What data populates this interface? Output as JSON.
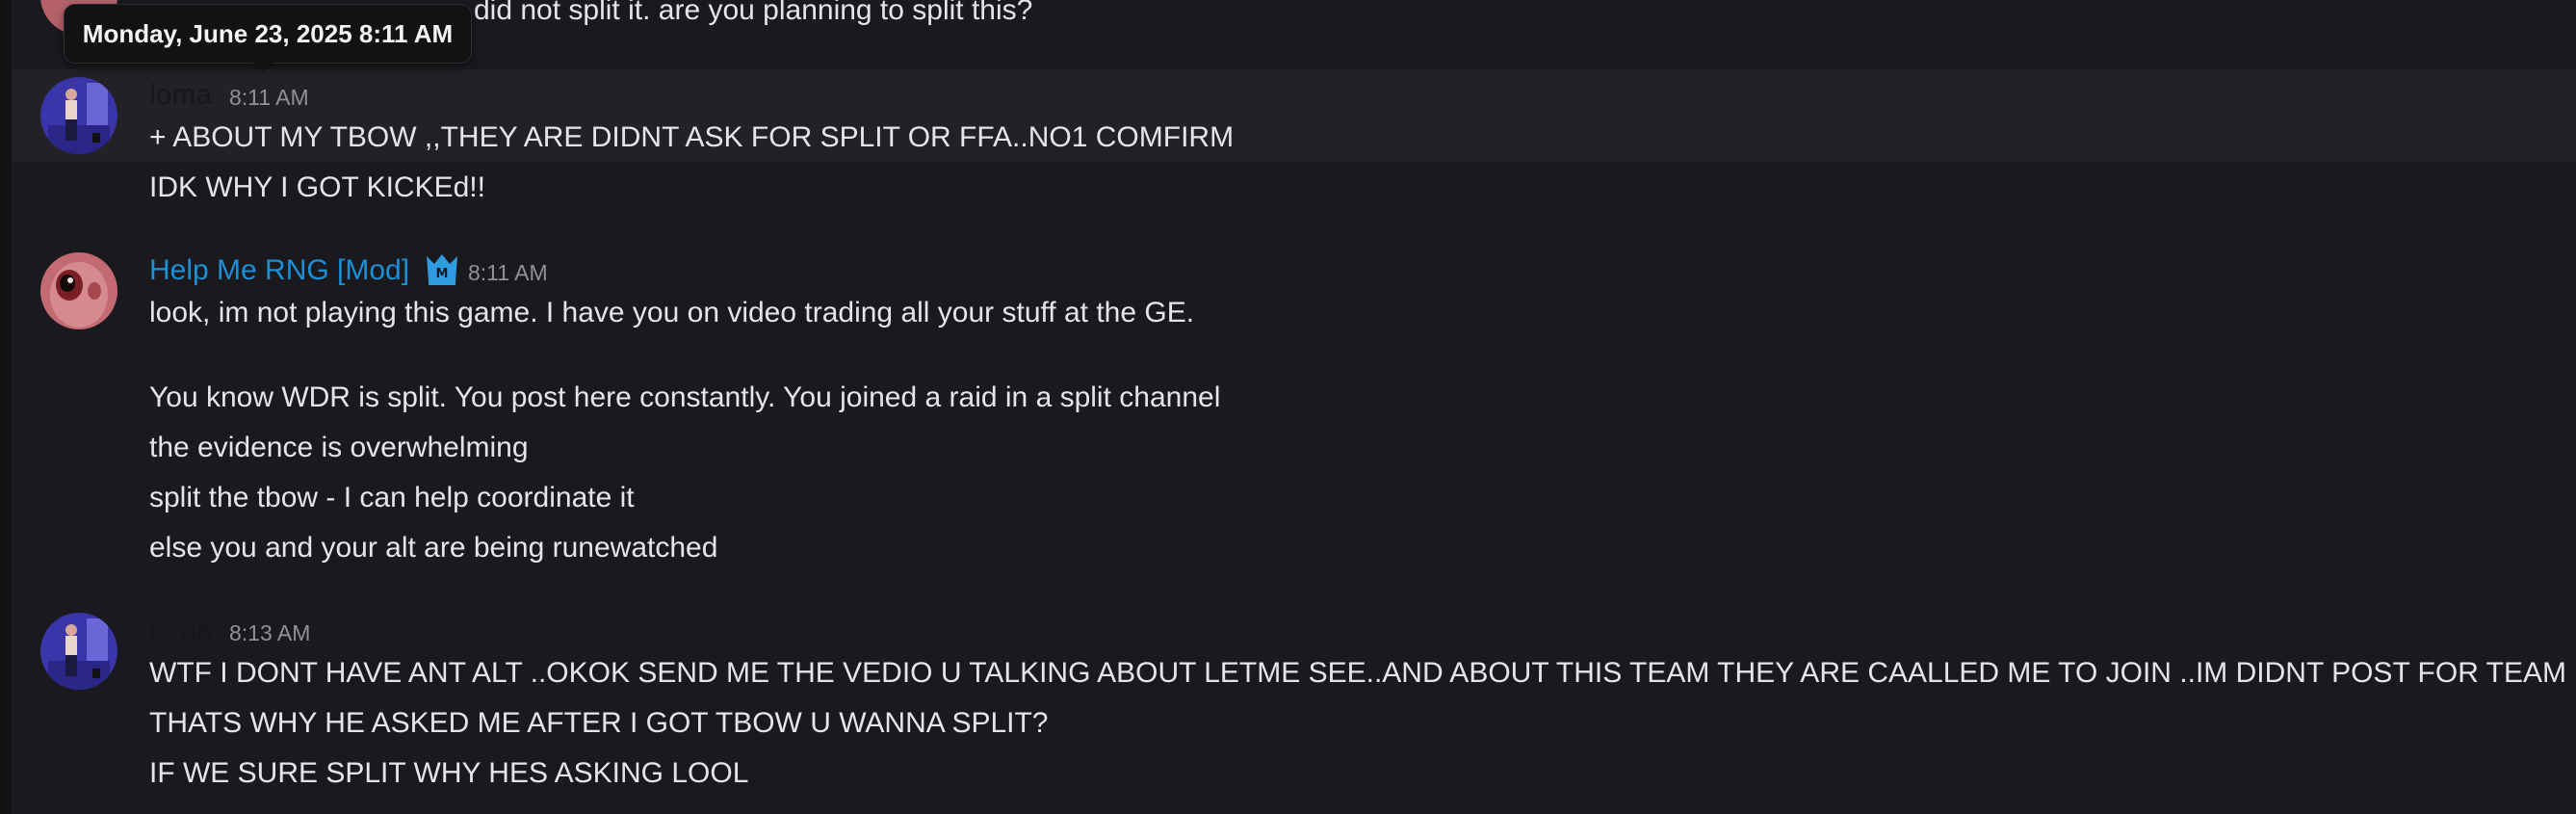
{
  "tooltip": {
    "text": "Monday, June 23, 2025 8:11 AM"
  },
  "colors": {
    "background": "#1a1a1e",
    "username_loma": "#17171a",
    "username_mod": "#1c8fd6",
    "mod_badge": "#2f9be0",
    "timestamp": "#8e9297",
    "text": "#e3e5e8"
  },
  "messages": [
    {
      "partial_text": "did not split it. are you planning to split this?"
    },
    {
      "author": "loma",
      "time": "8:11 AM",
      "avatar_icon": "loma-avatar-icon",
      "lines": [
        "+ ABOUT MY TBOW ,,THEY ARE DIDNT ASK FOR SPLIT OR FFA..NO1 COMFIRM",
        "IDK WHY I GOT KICKEd!!"
      ]
    },
    {
      "author": "Help Me RNG [Mod]",
      "time": "8:11 AM",
      "avatar_icon": "alien-avatar-icon",
      "badge_icon": "mod-crown-icon",
      "lines": [
        "look, im not playing this game. I have you on video trading all your stuff at the GE.",
        "You know WDR is split. You post here constantly. You joined a raid in a split channel",
        "the evidence is overwhelming",
        "split the tbow - I can help coordinate it",
        "else you and your alt are being runewatched"
      ]
    },
    {
      "author": "loma",
      "time": "8:13 AM",
      "avatar_icon": "loma-avatar-icon",
      "lines": [
        "WTF I DONT HAVE ANT ALT ..OKOK SEND ME THE VEDIO U TALKING ABOUT LETME SEE..AND ABOUT THIS TEAM THEY ARE CAALLED ME TO JOIN ..IM DIDNT POST FOR TEAM",
        "THATS WHY HE ASKED ME AFTER I GOT TBOW U WANNA SPLIT?",
        "IF WE SURE SPLIT WHY  HES ASKING LOOL"
      ]
    }
  ]
}
